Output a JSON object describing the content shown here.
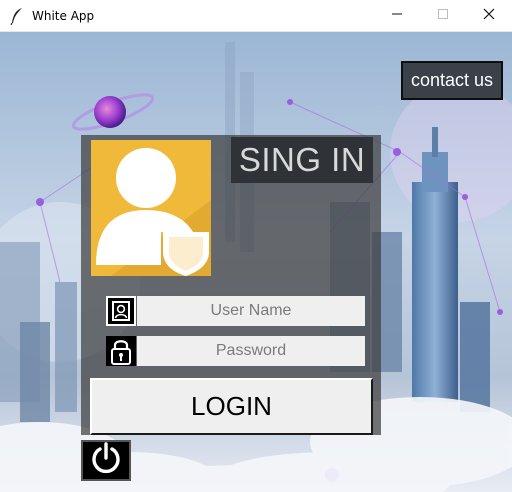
{
  "window": {
    "title": "White App",
    "icon": "feather-icon",
    "controls": [
      "minimize-icon",
      "maximize-icon",
      "close-icon"
    ]
  },
  "header": {
    "contact_label": "contact us"
  },
  "login": {
    "title": "SING IN",
    "avatar_icon": "user-shield-icon",
    "username": {
      "placeholder": "User Name",
      "value": "",
      "icon": "user-badge-icon"
    },
    "password": {
      "placeholder": "Password",
      "value": "",
      "icon": "padlock-icon"
    },
    "login_label": "LOGIN",
    "power_icon": "power-icon"
  },
  "colors": {
    "panel": "#3e3e3e",
    "avatar_bg": "#f0b93a",
    "title_bg": "#2f3337",
    "contact_bg": "#3a4148",
    "field_bg": "#efefef"
  }
}
